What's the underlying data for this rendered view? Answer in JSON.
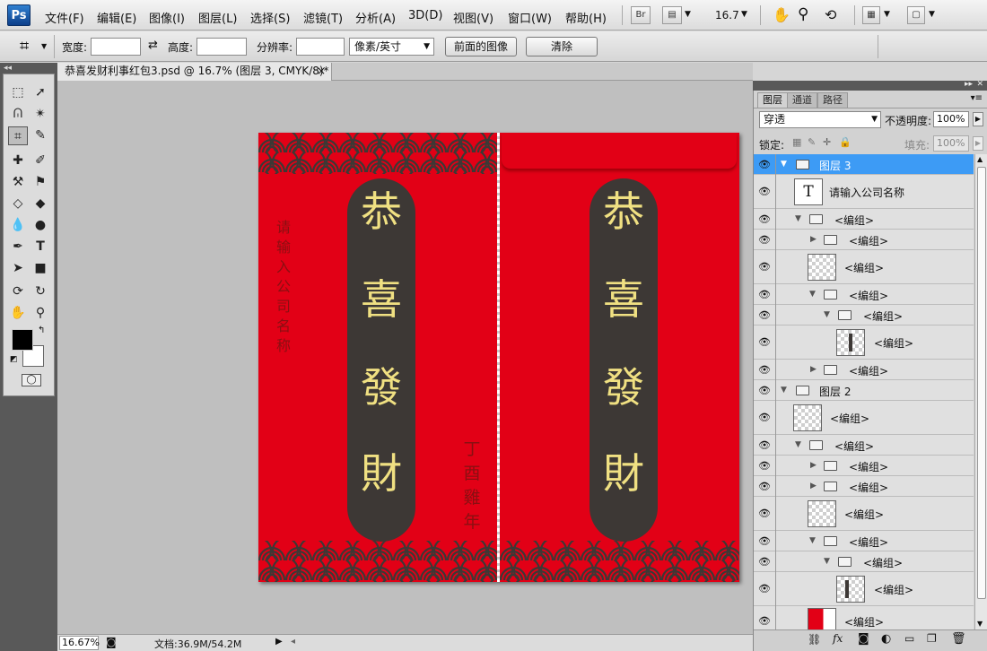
{
  "app": {
    "logo": "Ps"
  },
  "menu": [
    "文件(F)",
    "编辑(E)",
    "图像(I)",
    "图层(L)",
    "选择(S)",
    "滤镜(T)",
    "分析(A)",
    "3D(D)",
    "视图(V)",
    "窗口(W)",
    "帮助(H)"
  ],
  "appbar": {
    "bridge": "Br",
    "zoom": "16.7"
  },
  "options": {
    "width_label": "宽度:",
    "height_label": "高度:",
    "resolution_label": "分辨率:",
    "unit_value": "像素/英寸",
    "front_image_button": "前面的图像",
    "clear_button": "清除"
  },
  "document": {
    "tab_title": "恭喜发财利事红包3.psd @ 16.7% (图层 3, CMYK/8)*",
    "close": "×"
  },
  "artwork": {
    "blessing": [
      "恭",
      "喜",
      "發",
      "財"
    ],
    "company_vertical": [
      "请",
      "输",
      "入",
      "公",
      "司",
      "名",
      "称"
    ],
    "year_vertical": [
      "丁",
      "酉",
      "雞",
      "年"
    ]
  },
  "status": {
    "zoom": "16.67%",
    "doc_info": "文档:36.9M/54.2M"
  },
  "panel": {
    "tabs": [
      "图层",
      "通道",
      "路径"
    ],
    "blend_mode": "穿透",
    "opacity_label": "不透明度:",
    "opacity_value": "100%",
    "lock_label": "锁定:",
    "fill_label": "填充:",
    "fill_value": "100%",
    "layers": [
      {
        "name": "图层 3",
        "kind": "group",
        "indent": 0,
        "expanded": true,
        "selected": true
      },
      {
        "name": "请输入公司名称",
        "kind": "text",
        "indent": 1
      },
      {
        "name": "<编组>",
        "kind": "group",
        "indent": 1,
        "expanded": true
      },
      {
        "name": "<编组>",
        "kind": "group",
        "indent": 2,
        "expanded": false
      },
      {
        "name": "<编组>",
        "kind": "layer",
        "indent": 2,
        "thumb": "checker"
      },
      {
        "name": "<编组>",
        "kind": "group",
        "indent": 2,
        "expanded": true
      },
      {
        "name": "<编组>",
        "kind": "group",
        "indent": 3,
        "expanded": true
      },
      {
        "name": "<编组>",
        "kind": "layer",
        "indent": 4,
        "thumb": "bar"
      },
      {
        "name": "<编组>",
        "kind": "group",
        "indent": 2,
        "expanded": false
      },
      {
        "name": "图层 2",
        "kind": "group",
        "indent": 0,
        "expanded": true
      },
      {
        "name": "<编组>",
        "kind": "layer",
        "indent": 1,
        "thumb": "checker"
      },
      {
        "name": "<编组>",
        "kind": "group",
        "indent": 1,
        "expanded": true
      },
      {
        "name": "<编组>",
        "kind": "group",
        "indent": 2,
        "expanded": false
      },
      {
        "name": "<编组>",
        "kind": "group",
        "indent": 2,
        "expanded": false
      },
      {
        "name": "<编组>",
        "kind": "layer",
        "indent": 2,
        "thumb": "checker"
      },
      {
        "name": "<编组>",
        "kind": "group",
        "indent": 2,
        "expanded": true
      },
      {
        "name": "<编组>",
        "kind": "group",
        "indent": 3,
        "expanded": true
      },
      {
        "name": "<编组>",
        "kind": "layer",
        "indent": 4,
        "thumb": "bar"
      },
      {
        "name": "<编组>",
        "kind": "layer",
        "indent": 2,
        "thumb": "red"
      }
    ]
  },
  "colors": {
    "envelope_red": "#e20016",
    "pill_dark": "#3d3835",
    "gold_text": "#f0e082",
    "selected_layer": "#3d9bf5"
  }
}
